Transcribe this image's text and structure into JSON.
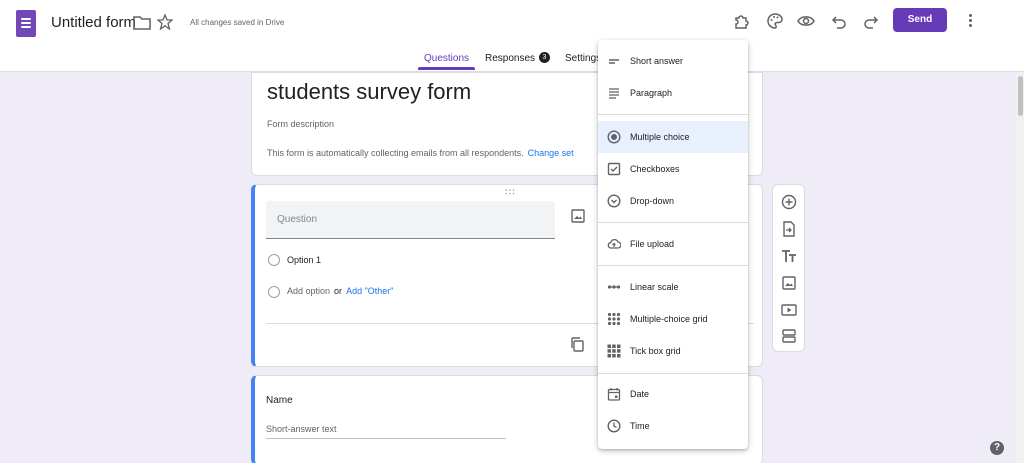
{
  "header": {
    "title": "Untitled form",
    "saved_status": "All changes saved in Drive",
    "send_label": "Send"
  },
  "tabs": [
    {
      "label": "Questions",
      "active": true
    },
    {
      "label": "Responses",
      "badge": "3"
    },
    {
      "label": "Settings"
    }
  ],
  "form": {
    "title": "students survey form",
    "description_placeholder": "Form description",
    "collect_note": "This form is automatically collecting emails from all respondents.",
    "change_link": "Change set"
  },
  "question_card": {
    "question_placeholder": "Question",
    "option1": "Option 1",
    "add_option": "Add option",
    "or": "or",
    "add_other": "Add \"Other\""
  },
  "name_card": {
    "label": "Name",
    "short_answer": "Short-answer text"
  },
  "menu": {
    "items": [
      {
        "label": "Short answer",
        "icon": "short-answer-icon"
      },
      {
        "label": "Paragraph",
        "icon": "paragraph-icon"
      },
      {
        "label": "Multiple choice",
        "icon": "radio-icon",
        "selected": true
      },
      {
        "label": "Checkboxes",
        "icon": "checkbox-icon"
      },
      {
        "label": "Drop-down",
        "icon": "dropdown-icon"
      },
      {
        "label": "File upload",
        "icon": "cloud-upload-icon"
      },
      {
        "label": "Linear scale",
        "icon": "linear-scale-icon"
      },
      {
        "label": "Multiple-choice grid",
        "icon": "dot-grid-icon"
      },
      {
        "label": "Tick box grid",
        "icon": "square-grid-icon"
      },
      {
        "label": "Date",
        "icon": "calendar-icon"
      },
      {
        "label": "Time",
        "icon": "clock-icon"
      }
    ]
  },
  "help": "?",
  "colors": {
    "accent": "#673ab7",
    "link": "#1a73e8",
    "highlight": "#e8f0fe",
    "card_accent": "#4285f4"
  }
}
